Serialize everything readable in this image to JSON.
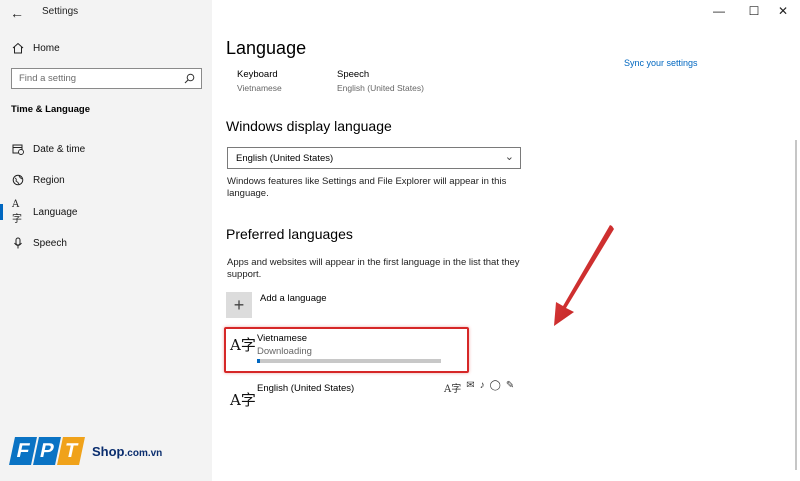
{
  "window": {
    "title": "Settings",
    "controls": {
      "minimize": "—",
      "maximize": "☐",
      "close": "✕"
    }
  },
  "sidebar": {
    "home_label": "Home",
    "search_placeholder": "Find a setting",
    "section_title": "Time & Language",
    "items": [
      {
        "label": "Date & time",
        "icon": "calendar-clock-icon"
      },
      {
        "label": "Region",
        "icon": "globe-icon"
      },
      {
        "label": "Language",
        "icon": "language-icon",
        "active": true
      },
      {
        "label": "Speech",
        "icon": "microphone-icon"
      }
    ]
  },
  "main": {
    "title": "Language",
    "sync_link": "Sync your settings",
    "quick": [
      {
        "label": "Keyboard",
        "value": "Vietnamese"
      },
      {
        "label": "Speech",
        "value": "English (United States)"
      }
    ],
    "display_language": {
      "heading": "Windows display language",
      "selected": "English (United States)",
      "description": "Windows features like Settings and File Explorer will appear in this language."
    },
    "preferred": {
      "heading": "Preferred languages",
      "description": "Apps and websites will appear in the first language in the list that they support.",
      "add_label": "Add a language",
      "languages": [
        {
          "name": "Vietnamese",
          "status": "Downloading",
          "progress": 0.01
        },
        {
          "name": "English (United States)"
        }
      ]
    }
  },
  "branding": {
    "letters": [
      "F",
      "P",
      "T"
    ],
    "shop": "Shop",
    "domain": ".com.vn"
  },
  "colors": {
    "accent": "#0067c0",
    "highlight": "#d62727",
    "logo_blue": "#0a73c4",
    "logo_orange": "#f0a21a"
  }
}
